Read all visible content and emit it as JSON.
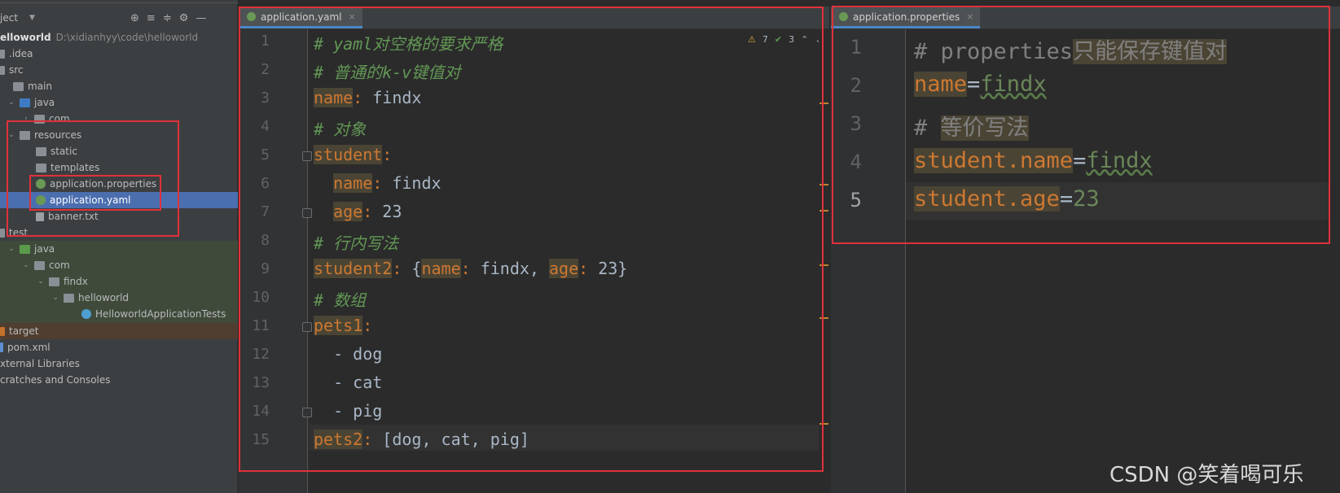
{
  "project": {
    "title": "ject",
    "rows": [
      {
        "label": "elloworld",
        "path": "D:\\xidianhyy\\code\\helloworld"
      },
      {
        "label": ".idea"
      },
      {
        "label": "src"
      },
      {
        "label": "main"
      },
      {
        "label": "java"
      },
      {
        "label": "com"
      },
      {
        "label": "resources"
      },
      {
        "label": "static"
      },
      {
        "label": "templates"
      },
      {
        "label": "application.properties"
      },
      {
        "label": "application.yaml"
      },
      {
        "label": "banner.txt"
      },
      {
        "label": "test"
      },
      {
        "label": "java"
      },
      {
        "label": "com"
      },
      {
        "label": "findx"
      },
      {
        "label": "helloworld"
      },
      {
        "label": "HelloworldApplicationTests"
      },
      {
        "label": "target"
      },
      {
        "label": "pom.xml"
      },
      {
        "label": "xternal Libraries"
      },
      {
        "label": "cratches and Consoles"
      }
    ]
  },
  "yaml_tab": {
    "label": "application.yaml",
    "close": "×"
  },
  "props_tab": {
    "label": "application.properties",
    "close": "×"
  },
  "inspections": {
    "warnings": "7",
    "checks": "3"
  },
  "yaml_lines": {
    "n1": "1",
    "n2": "2",
    "n3": "3",
    "n4": "4",
    "n5": "5",
    "n6": "6",
    "n7": "7",
    "n8": "8",
    "n9": "9",
    "n10": "10",
    "n11": "11",
    "n12": "12",
    "n13": "13",
    "n14": "14",
    "n15": "15",
    "l1": "# yaml对空格的要求严格",
    "l2": "# 普通的k-v键值对",
    "l3_key": "name",
    "l3_val": " findx",
    "l4": "# 对象",
    "l5_key": "student",
    "l6_key": "name",
    "l6_val": " findx",
    "l7_key": "age",
    "l7_val": " 23",
    "l8": "# 行内写法",
    "l9_key": "student2",
    "l9_a": " {",
    "l9_k1": "name",
    "l9_v1": " findx, ",
    "l9_k2": "age",
    "l9_v2": " 23}",
    "l10": "# 数组",
    "l11_key": "pets1",
    "l12": "  - dog",
    "l13": "  - cat",
    "l14": "  - pig",
    "l15_key": "pets2",
    "l15_val": " [dog, cat, pig]"
  },
  "props_lines": {
    "n1": "1",
    "n2": "2",
    "n3": "3",
    "n4": "4",
    "n5": "5",
    "l1_a": "# properties",
    "l1_b": "只能保存键值对",
    "l2_key": "name",
    "l2_eq": "=",
    "l2_val": "findx",
    "l3_a": "# ",
    "l3_b": "等价写法",
    "l4_key": "student.name",
    "l4_eq": "=",
    "l4_val": "findx",
    "l5_key": "student.age",
    "l5_eq": "=",
    "l5_val": "23"
  },
  "watermark": "CSDN @笑着喝可乐",
  "colors": {
    "highlight_box": "#e0313a",
    "selection": "#4b6eaf",
    "key": "#cc7832"
  }
}
